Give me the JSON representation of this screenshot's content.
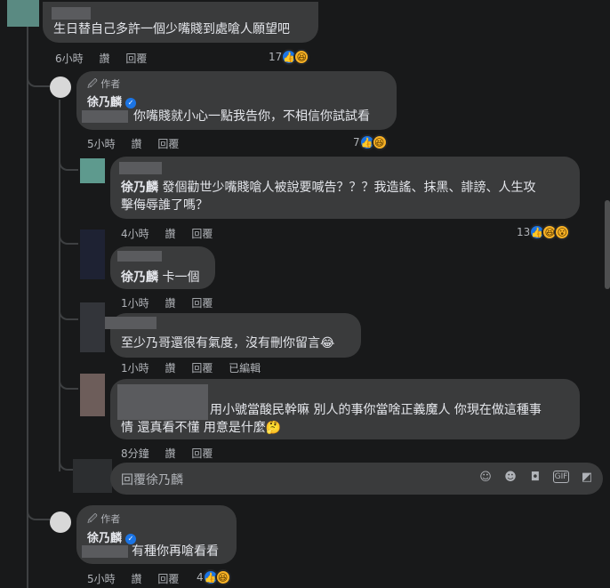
{
  "colors": {
    "background": "#18191a",
    "bubble": "#3a3b3c",
    "link": "#1b74e4",
    "meta": "#b0b3b8"
  },
  "top_comment": {
    "text": "生日替自己多許一個少嘴賤到處嗆人願望吧",
    "time": "6小時",
    "like": "讚",
    "reply": "回覆",
    "reaction_count": "17",
    "reaction_icons": [
      "like-icon",
      "haha-icon"
    ]
  },
  "author_reply_1": {
    "author_tag": "作者",
    "name": "徐乃麟",
    "text": "你嘴賤就小心一點我告你，不相信你試試看",
    "time": "5小時",
    "like": "讚",
    "reply": "回覆",
    "reaction_count": "7",
    "reaction_icons": [
      "like-icon",
      "haha-icon"
    ]
  },
  "reply_a": {
    "mention": "徐乃麟",
    "text_line1": " 發個勸世少嘴賤嗆人被說要喊告？？？我造謠、抹黑、誹謗、人生攻",
    "text_line2": "擊侮辱誰了嗎？",
    "time": "4小時",
    "like": "讚",
    "reply": "回覆",
    "reaction_count": "13",
    "reaction_icons": [
      "like-icon",
      "haha-icon",
      "wow-icon"
    ]
  },
  "reply_b": {
    "mention": "徐乃麟",
    "text": " 卡一個",
    "time": "1小時",
    "like": "讚",
    "reply": "回覆"
  },
  "reply_c": {
    "text": "至少乃哥還很有氣度，沒有刪你留言😂",
    "time": "1小時",
    "like": "讚",
    "reply": "回覆",
    "edited": "已編輯"
  },
  "reply_d": {
    "text_line1": "用小號當酸民幹嘛 別人的事你當啥正義魔人 你現在做這種事",
    "text_line2": "情 還真看不懂 用意是什麼🤔",
    "time": "8分鐘",
    "like": "讚",
    "reply": "回覆"
  },
  "reply_input": {
    "placeholder": "回覆徐乃麟",
    "icons": [
      "avatar-sticker-icon",
      "emoji-icon",
      "camera-icon",
      "gif-icon",
      "sticker-icon"
    ]
  },
  "author_reply_2": {
    "author_tag": "作者",
    "name": "徐乃麟",
    "text": "有種你再嗆看看",
    "time": "5小時",
    "like": "讚",
    "reply": "回覆",
    "reaction_count": "4",
    "reaction_icons": [
      "like-icon",
      "haha-icon"
    ]
  }
}
